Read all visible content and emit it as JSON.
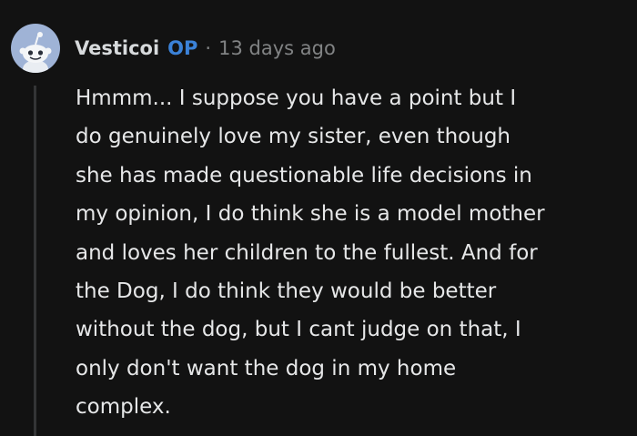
{
  "comment": {
    "author": "Vesticoi",
    "op_badge": "OP",
    "separator": "·",
    "timestamp": "13 days ago",
    "avatar_icon": "snoo-avatar-icon",
    "body_lines": [
      "Hmmm... I suppose you have a point but I",
      "do genuinely love my sister, even though",
      "she has made questionable life decisions in",
      "my opinion, I do think she is a model mother",
      "and loves her children to the fullest. And for",
      "the Dog, I do think they would be better",
      "without the dog, but I cant judge on that, I",
      "only don't want the dog in my home",
      "complex."
    ]
  },
  "colors": {
    "background": "#121212",
    "op_accent": "#3b82d8",
    "muted_text": "#818384",
    "avatar_bg": "#9fb3d6"
  }
}
